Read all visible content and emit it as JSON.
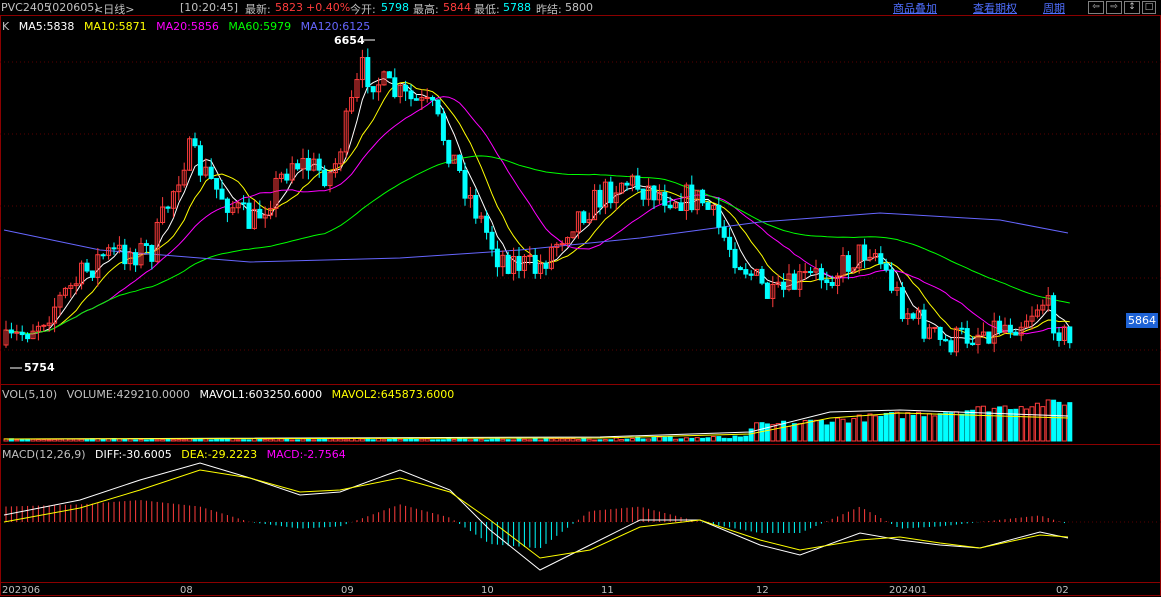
{
  "header": {
    "symbol": "PVC2405",
    "code": "(020605)",
    "period": "<日线>",
    "time": "[10:20:45]",
    "latest_label": "最新:",
    "latest_value": "5823",
    "change_pct": "+0.40%",
    "open_label": "今开:",
    "open_value": "5798",
    "high_label": "最高:",
    "high_value": "5844",
    "low_label": "最低:",
    "low_value": "5788",
    "prev_close_label": "昨结:",
    "prev_close_value": "5800"
  },
  "toolbar": {
    "overlay_label": "商品叠加",
    "contract_label": "查看期权",
    "cycle_label": "周期"
  },
  "price_panel": {
    "k_label": "K",
    "ma5": "MA5:5838",
    "ma10": "MA10:5871",
    "ma20": "MA20:5856",
    "ma60": "MA60:5979",
    "ma120": "MA120:6125",
    "max_label": "6654",
    "min_label": "5754",
    "current_price_tag": "5864"
  },
  "volume_panel": {
    "title": "VOL(5,10)",
    "volume": "VOLUME:429210.0000",
    "mavol1": "MAVOL1:603250.6000",
    "mavol2": "MAVOL2:645873.6000"
  },
  "macd_panel": {
    "title": "MACD(12,26,9)",
    "diff": "DIFF:-30.6005",
    "dea": "DEA:-29.2223",
    "macd": "MACD:-2.7564"
  },
  "date_axis": [
    "202306",
    "08",
    "09",
    "10",
    "11",
    "12",
    "202401",
    "02"
  ],
  "colors": {
    "up": "#ff3c3c",
    "down": "#00ffff",
    "ma5": "#ffffff",
    "ma10": "#ffff00",
    "ma20": "#ff00ff",
    "ma60": "#00ff00",
    "ma120": "#6666ff",
    "grid": "#5a0000",
    "link": "#4f6fff"
  }
}
